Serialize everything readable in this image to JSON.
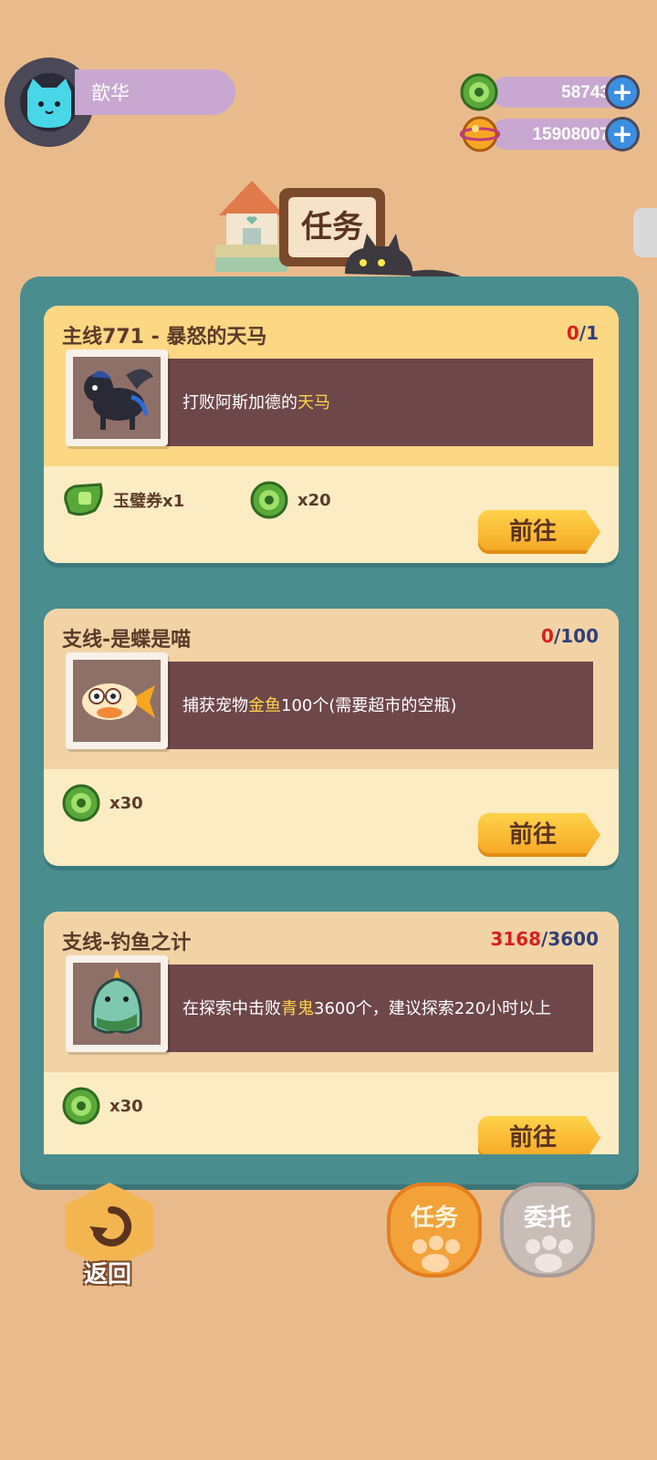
{
  "player": {
    "name": "歆华"
  },
  "currencies": [
    {
      "name": "jade-coin-icon",
      "value": "58743"
    },
    {
      "name": "gold-coin-icon",
      "value": "15908007"
    }
  ],
  "header": {
    "title": "任务"
  },
  "quests": [
    {
      "title": "主线771 - 暴怒的天马",
      "progress_current": "0",
      "progress_separator": "/",
      "progress_total": "1",
      "desc_before": "打败阿斯加德的",
      "desc_highlight": "天马",
      "desc_after": "",
      "portrait": "pegasus-monster-icon",
      "rewards": [
        {
          "icon": "jade-ticket-icon",
          "label": "玉璧券x1"
        },
        {
          "icon": "jade-coin-icon",
          "label": "x20"
        }
      ],
      "button": "前往"
    },
    {
      "title": "支线-是蝶是喵",
      "progress_current": "0",
      "progress_separator": "/",
      "progress_total": "100",
      "desc_before": "捕获宠物",
      "desc_highlight": "金鱼",
      "desc_after": "100个(需要超市的空瓶)",
      "portrait": "goldfish-pet-icon",
      "rewards": [
        {
          "icon": "jade-coin-icon",
          "label": "x30"
        }
      ],
      "button": "前往"
    },
    {
      "title": "支线-钓鱼之计",
      "progress_current": "3168",
      "progress_separator": "/",
      "progress_total": "3600",
      "desc_before": "在探索中击败",
      "desc_highlight": "青鬼",
      "desc_after": "3600个，建议探索220小时以上",
      "portrait": "green-ghost-monster-icon",
      "rewards": [
        {
          "icon": "jade-coin-icon",
          "label": "x30"
        }
      ],
      "button": "前往"
    }
  ],
  "footer": {
    "back_label": "返回",
    "tab_quests": "任务",
    "tab_commission": "委托"
  },
  "colors": {
    "background": "#e9bb8c",
    "panel": "#4a8d8f",
    "card_header": "#fcd784",
    "card_body": "#fcecc4",
    "desc_box": "#6e474a",
    "button": "#f5a623",
    "highlight": "#ffd54a"
  }
}
